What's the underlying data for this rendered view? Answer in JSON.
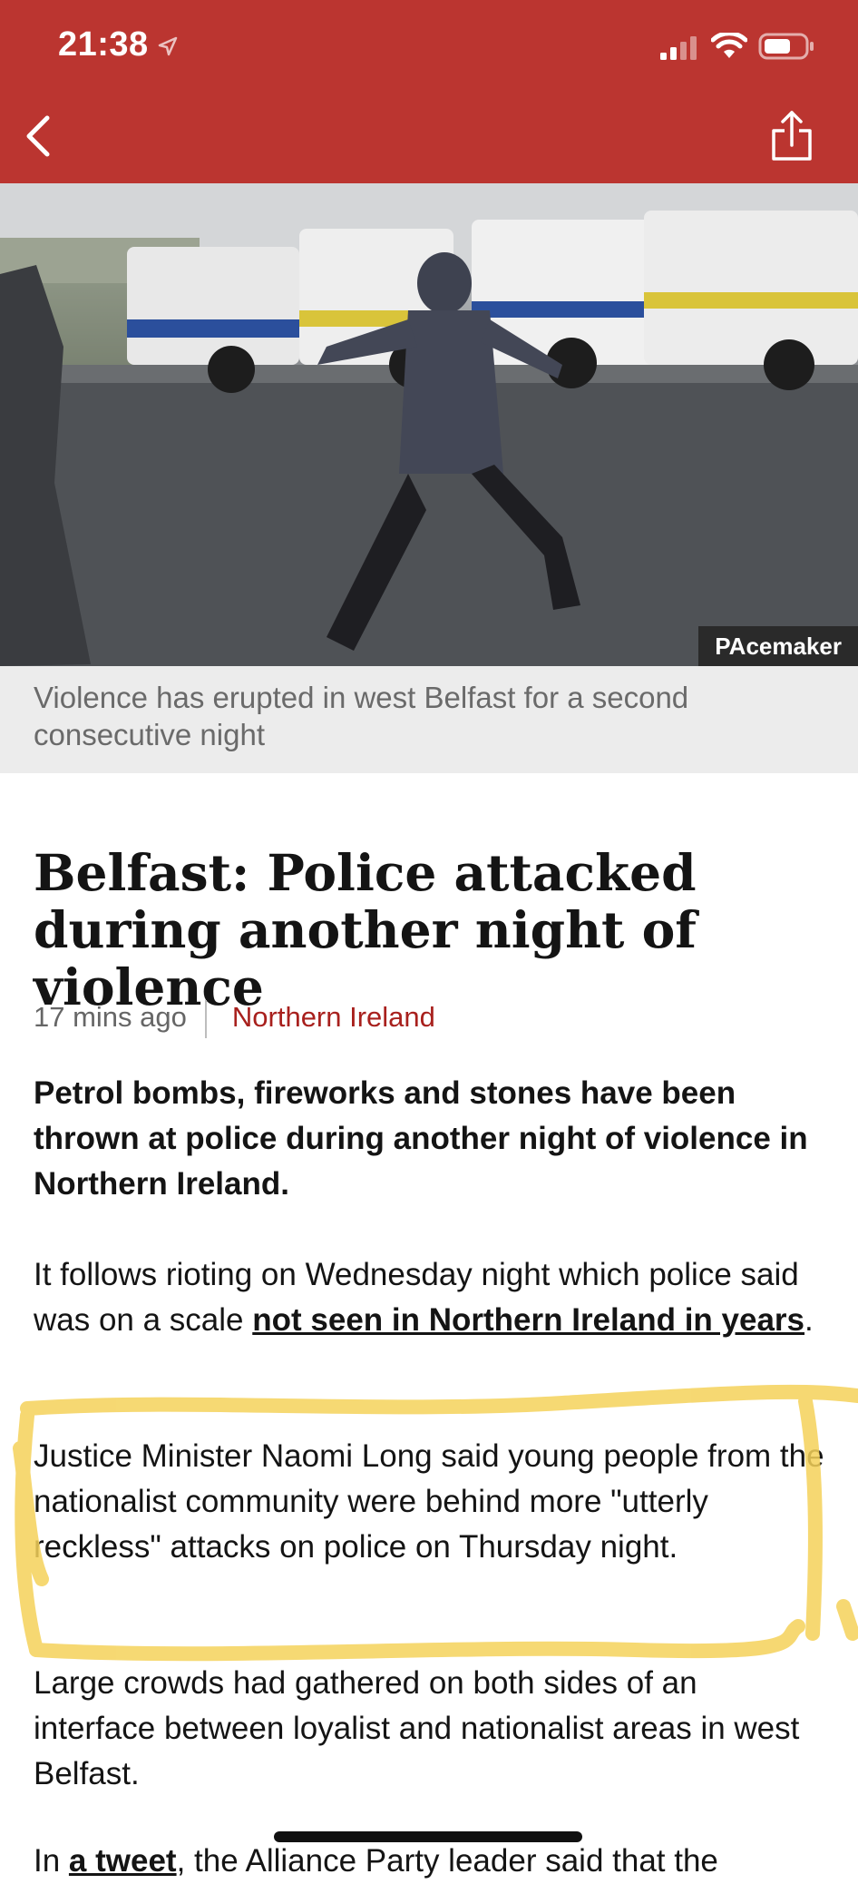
{
  "status_bar": {
    "time": "21:38",
    "icons": [
      "location-arrow-icon",
      "cellular-signal-icon",
      "wifi-icon",
      "battery-icon"
    ]
  },
  "nav": {
    "back_icon": "chevron-left-icon",
    "share_icon": "share-icon",
    "background_color": "#bb3530"
  },
  "hero": {
    "credit": "PAcemaker",
    "caption": "Violence has erupted in west Belfast for a second consecutive night"
  },
  "article": {
    "headline": "Belfast: Police attacked during another night of violence",
    "timestamp": "17 mins ago",
    "topic": "Northern Ireland",
    "topic_color": "#a8201d",
    "lead": "Petrol bombs, fireworks and stones have been thrown at police during another night of violence in Northern Ireland.",
    "p1_before": "It follows rioting on Wednesday night which police said was on a scale ",
    "p1_link": "not seen in Northern Ireland in years",
    "p1_after": ".",
    "p2": "Justice Minister Naomi Long said young people from the nationalist community were behind more \"utterly reckless\" attacks on police on Thursday night.",
    "p3": "Large crowds had gathered on both sides of an interface between loyalist and nationalist areas in west Belfast.",
    "p4_before": "In ",
    "p4_link": "a tweet",
    "p4_after": ", the Alliance Party leader said that the"
  },
  "annotation": {
    "highlight_color": "#f5d25a"
  }
}
